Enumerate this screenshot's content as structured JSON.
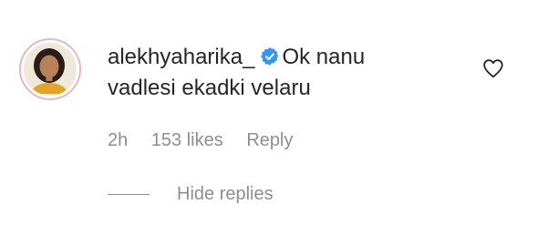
{
  "comment": {
    "username": "alekhyaharika_",
    "verified": true,
    "text": "Ok nanu vadlesi ekadki velaru",
    "time": "2h",
    "likes": "153 likes",
    "reply_label": "Reply",
    "replies_toggle_label": "Hide replies"
  },
  "icons": {
    "verified": "verified-badge-icon",
    "like": "heart-outline-icon"
  },
  "colors": {
    "verified_blue": "#3797f0",
    "text": "#262626",
    "secondary_text": "#8e8e8e",
    "avatar_ring": "#e3b7c6"
  }
}
